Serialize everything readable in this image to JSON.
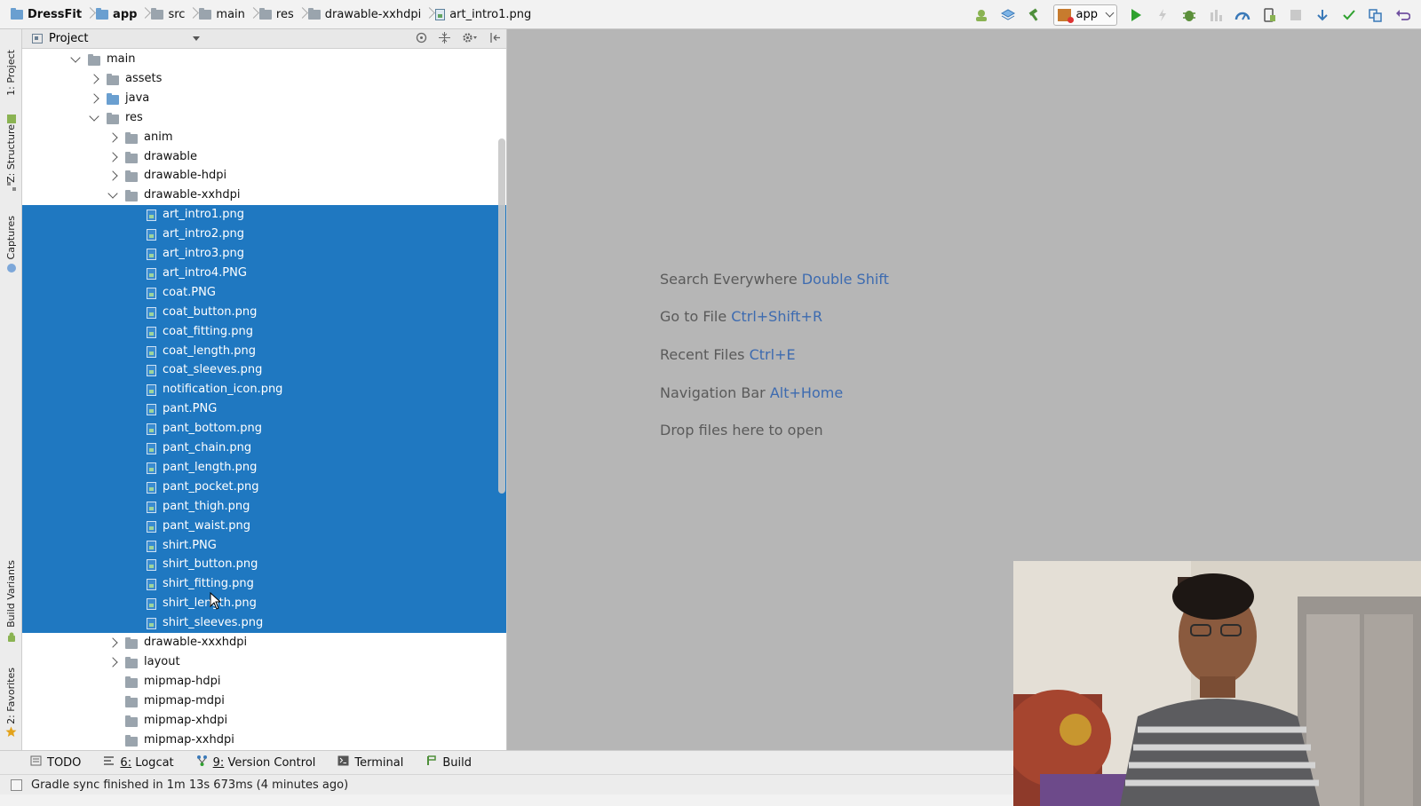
{
  "breadcrumb": [
    {
      "label": "DressFit",
      "icon": "project-folder-icon",
      "bold": true
    },
    {
      "label": "app",
      "icon": "module-folder-icon",
      "bold": true
    },
    {
      "label": "src",
      "icon": "folder-icon",
      "bold": false
    },
    {
      "label": "main",
      "icon": "folder-icon",
      "bold": false
    },
    {
      "label": "res",
      "icon": "folder-icon",
      "bold": false
    },
    {
      "label": "drawable-xxhdpi",
      "icon": "folder-icon",
      "bold": false
    },
    {
      "label": "art_intro1.png",
      "icon": "image-file-icon",
      "bold": false
    }
  ],
  "toolbar": {
    "run_config_label": "app",
    "buttons": [
      "android-profile-icon",
      "sync-icon",
      "make-hammer-icon",
      "run-config",
      "run-icon",
      "apply-changes-icon",
      "debug-icon",
      "attach-debugger-icon",
      "profiler-icon",
      "device-manager-icon",
      "stop-icon",
      "vcs-update-icon",
      "vcs-commit-icon",
      "compare-icon",
      "undo-icon"
    ],
    "colors": {
      "run": "#2fa12f",
      "accent": "#3d6bb0"
    }
  },
  "left_tool_tabs": [
    {
      "label": "1: Project",
      "icon": "project-icon"
    },
    {
      "label": "Z: Structure",
      "icon": "structure-icon"
    },
    {
      "label": "Captures",
      "icon": "captures-icon"
    },
    {
      "label": "Build Variants",
      "icon": "android-icon"
    },
    {
      "label": "2: Favorites",
      "icon": "star-icon"
    }
  ],
  "project_panel": {
    "title": "Project",
    "header_icons": [
      "locate-icon",
      "collapse-icon",
      "gear-icon",
      "hide-icon"
    ]
  },
  "tree": [
    {
      "label": "main",
      "depth": 0,
      "type": "folder",
      "arrow": "down",
      "selected": false
    },
    {
      "label": "assets",
      "depth": 1,
      "type": "assets",
      "arrow": "right",
      "selected": false
    },
    {
      "label": "java",
      "depth": 1,
      "type": "source",
      "arrow": "right",
      "selected": false
    },
    {
      "label": "res",
      "depth": 1,
      "type": "res",
      "arrow": "down",
      "selected": false
    },
    {
      "label": "anim",
      "depth": 2,
      "type": "folder",
      "arrow": "right",
      "selected": false
    },
    {
      "label": "drawable",
      "depth": 2,
      "type": "folder",
      "arrow": "right",
      "selected": false
    },
    {
      "label": "drawable-hdpi",
      "depth": 2,
      "type": "folder",
      "arrow": "right",
      "selected": false
    },
    {
      "label": "drawable-xxhdpi",
      "depth": 2,
      "type": "folder",
      "arrow": "down",
      "selected": false
    },
    {
      "label": "art_intro1.png",
      "depth": 3,
      "type": "file",
      "arrow": "",
      "selected": true
    },
    {
      "label": "art_intro2.png",
      "depth": 3,
      "type": "file",
      "arrow": "",
      "selected": true
    },
    {
      "label": "art_intro3.png",
      "depth": 3,
      "type": "file",
      "arrow": "",
      "selected": true
    },
    {
      "label": "art_intro4.PNG",
      "depth": 3,
      "type": "file",
      "arrow": "",
      "selected": true
    },
    {
      "label": "coat.PNG",
      "depth": 3,
      "type": "file",
      "arrow": "",
      "selected": true
    },
    {
      "label": "coat_button.png",
      "depth": 3,
      "type": "file",
      "arrow": "",
      "selected": true
    },
    {
      "label": "coat_fitting.png",
      "depth": 3,
      "type": "file",
      "arrow": "",
      "selected": true
    },
    {
      "label": "coat_length.png",
      "depth": 3,
      "type": "file",
      "arrow": "",
      "selected": true
    },
    {
      "label": "coat_sleeves.png",
      "depth": 3,
      "type": "file",
      "arrow": "",
      "selected": true
    },
    {
      "label": "notification_icon.png",
      "depth": 3,
      "type": "file",
      "arrow": "",
      "selected": true
    },
    {
      "label": "pant.PNG",
      "depth": 3,
      "type": "file",
      "arrow": "",
      "selected": true
    },
    {
      "label": "pant_bottom.png",
      "depth": 3,
      "type": "file",
      "arrow": "",
      "selected": true
    },
    {
      "label": "pant_chain.png",
      "depth": 3,
      "type": "file",
      "arrow": "",
      "selected": true
    },
    {
      "label": "pant_length.png",
      "depth": 3,
      "type": "file",
      "arrow": "",
      "selected": true
    },
    {
      "label": "pant_pocket.png",
      "depth": 3,
      "type": "file",
      "arrow": "",
      "selected": true
    },
    {
      "label": "pant_thigh.png",
      "depth": 3,
      "type": "file",
      "arrow": "",
      "selected": true
    },
    {
      "label": "pant_waist.png",
      "depth": 3,
      "type": "file",
      "arrow": "",
      "selected": true
    },
    {
      "label": "shirt.PNG",
      "depth": 3,
      "type": "file",
      "arrow": "",
      "selected": true
    },
    {
      "label": "shirt_button.png",
      "depth": 3,
      "type": "file",
      "arrow": "",
      "selected": true
    },
    {
      "label": "shirt_fitting.png",
      "depth": 3,
      "type": "file",
      "arrow": "",
      "selected": true
    },
    {
      "label": "shirt_length.png",
      "depth": 3,
      "type": "file",
      "arrow": "",
      "selected": true
    },
    {
      "label": "shirt_sleeves.png",
      "depth": 3,
      "type": "file",
      "arrow": "",
      "selected": true
    },
    {
      "label": "drawable-xxxhdpi",
      "depth": 2,
      "type": "folder",
      "arrow": "right",
      "selected": false
    },
    {
      "label": "layout",
      "depth": 2,
      "type": "folder",
      "arrow": "right",
      "selected": false
    },
    {
      "label": "mipmap-hdpi",
      "depth": 2,
      "type": "folder",
      "arrow": "",
      "selected": false
    },
    {
      "label": "mipmap-mdpi",
      "depth": 2,
      "type": "folder",
      "arrow": "",
      "selected": false
    },
    {
      "label": "mipmap-xhdpi",
      "depth": 2,
      "type": "folder",
      "arrow": "",
      "selected": false
    },
    {
      "label": "mipmap-xxhdpi",
      "depth": 2,
      "type": "folder",
      "arrow": "",
      "selected": false
    }
  ],
  "editor_hints": [
    {
      "text": "Search Everywhere",
      "shortcut": "Double Shift"
    },
    {
      "text": "Go to File",
      "shortcut": "Ctrl+Shift+R"
    },
    {
      "text": "Recent Files",
      "shortcut": "Ctrl+E"
    },
    {
      "text": "Navigation Bar",
      "shortcut": "Alt+Home"
    },
    {
      "text": "Drop files here to open",
      "shortcut": ""
    }
  ],
  "bottom_tabs": [
    {
      "label": "TODO",
      "mnemonic": "",
      "icon": "todo-icon"
    },
    {
      "label": "Logcat",
      "mnemonic": "6:",
      "icon": "logcat-icon"
    },
    {
      "label": "Version Control",
      "mnemonic": "9:",
      "icon": "version-control-icon"
    },
    {
      "label": "Terminal",
      "mnemonic": "",
      "icon": "terminal-icon"
    },
    {
      "label": "Build",
      "mnemonic": "",
      "icon": "build-icon"
    }
  ],
  "status": {
    "text": "Gradle sync finished in 1m 13s 673ms (4 minutes ago)"
  },
  "colors": {
    "selection": "#1f78c1",
    "editor_bg": "#b6b6b6",
    "shortcut": "#3d6bb0"
  }
}
